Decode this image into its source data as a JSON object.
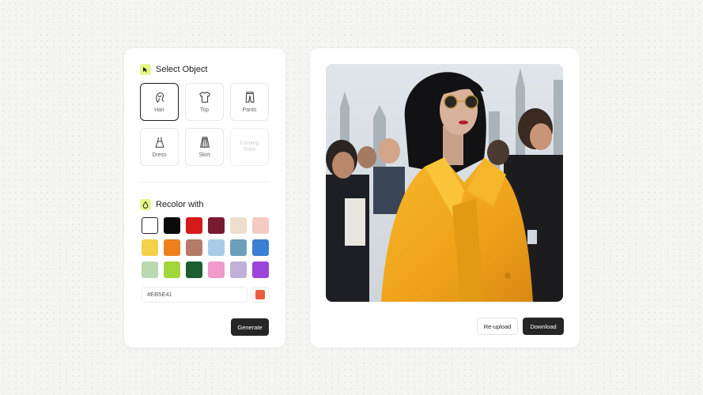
{
  "select_object": {
    "title": "Select Object",
    "items": [
      {
        "label": "Hair",
        "icon": "hair-icon",
        "state": "selected"
      },
      {
        "label": "Top",
        "icon": "tshirt-icon",
        "state": "normal"
      },
      {
        "label": "Pants",
        "icon": "pants-icon",
        "state": "normal"
      },
      {
        "label": "Dress",
        "icon": "dress-icon",
        "state": "normal"
      },
      {
        "label": "Skirt",
        "icon": "skirt-icon",
        "state": "normal"
      },
      {
        "label": "Coming Soon",
        "icon": "none",
        "state": "disabled"
      }
    ]
  },
  "recolor": {
    "title": "Recolor with",
    "swatches": [
      "#ffffff",
      "#0a0a0a",
      "#d61a1a",
      "#7a1a30",
      "#eedfcc",
      "#f2cbc4",
      "#f5d04a",
      "#ee8020",
      "#b47c68",
      "#a9cbe6",
      "#6d9fbd",
      "#3a7fd4",
      "#b9d9b0",
      "#9fd63a",
      "#1d5e30",
      "#ef9acb",
      "#bfb0d9",
      "#9b45d8"
    ],
    "selected_index": 0,
    "hex_value": "#EB5E41",
    "preview_color": "#EB5E41",
    "generate_label": "Generate"
  },
  "preview": {
    "image_alt": "woman-in-yellow-coat-photo",
    "reupload_label": "Re-upload",
    "download_label": "Download"
  },
  "colors": {
    "accent": "#e4f88a",
    "dark_button": "#262626",
    "coat_yellow": "#f0a81c"
  }
}
